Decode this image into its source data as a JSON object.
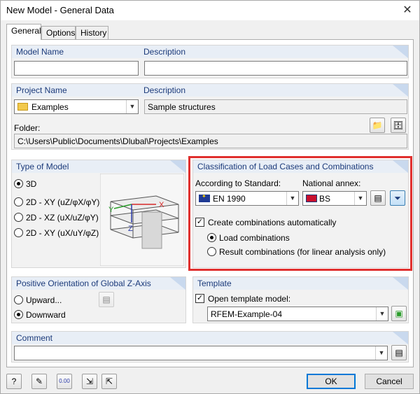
{
  "window": {
    "title": "New Model - General Data",
    "close_glyph": "✕"
  },
  "tabs": [
    "General",
    "Options",
    "History"
  ],
  "model_name": {
    "label": "Model Name",
    "value": ""
  },
  "description": {
    "label": "Description",
    "value": ""
  },
  "project_name": {
    "label": "Project Name",
    "value": "Examples"
  },
  "project_description": {
    "label": "Description",
    "value": "Sample structures"
  },
  "folder": {
    "label": "Folder:",
    "value": "C:\\Users\\Public\\Documents\\Dlubal\\Projects\\Examples"
  },
  "type_of_model": {
    "title": "Type of Model",
    "options": [
      "3D",
      "2D - XY (uZ/φX/φY)",
      "2D - XZ (uX/uZ/φY)",
      "2D - XY (uX/uY/φZ)"
    ],
    "selected": "3D",
    "axis_labels": {
      "y": "Y",
      "x": "X",
      "z": "Z"
    }
  },
  "classification": {
    "title": "Classification of Load Cases and Combinations",
    "standard_label": "According to Standard:",
    "standard_value": "EN 1990",
    "annex_label": "National annex:",
    "annex_value": "BS",
    "create_label": "Create combinations automatically",
    "create_checked": true,
    "load_combinations_label": "Load combinations",
    "result_combinations_label": "Result combinations (for linear analysis only)",
    "selected_combination": "Load combinations"
  },
  "orientation": {
    "title": "Positive Orientation of Global Z-Axis",
    "upward_label": "Upward...",
    "downward_label": "Downward",
    "selected": "Downward"
  },
  "template": {
    "title": "Template",
    "open_label": "Open template model:",
    "open_checked": true,
    "value": "RFEM-Example-04"
  },
  "comment": {
    "title": "Comment",
    "value": ""
  },
  "buttons": {
    "ok": "OK",
    "cancel": "Cancel"
  },
  "icons": {
    "help": "help-icon",
    "edit": "edit-icon",
    "units": "units-icon",
    "units_text": "0.00",
    "import": "import-icon",
    "export": "export-icon"
  },
  "colors": {
    "highlight": "#e0302e",
    "group_title": "#1b3a7a",
    "default_button": "#0078d7"
  }
}
